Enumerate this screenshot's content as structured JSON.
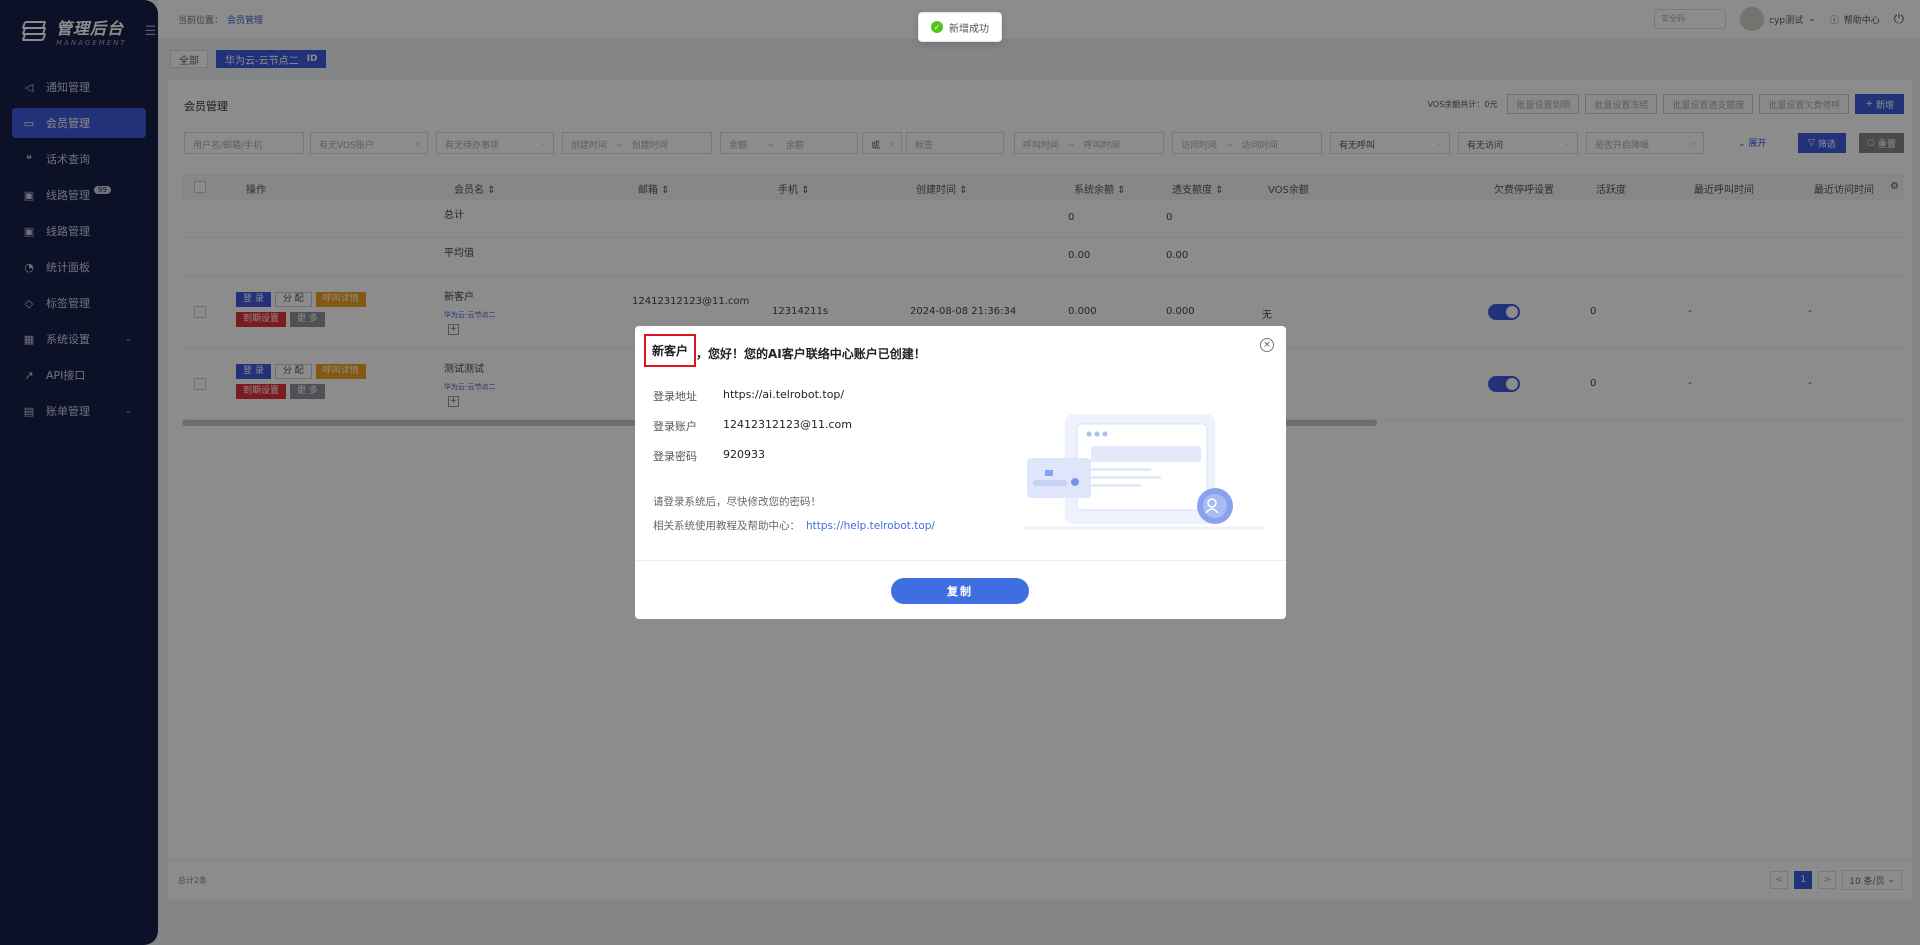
{
  "app": {
    "logo_title": "管理后台",
    "logo_sub": "MANAGEMENT"
  },
  "sidebar": {
    "items": [
      {
        "label": "通知管理",
        "icon": "bell-icon"
      },
      {
        "label": "会员管理",
        "icon": "member-icon",
        "active": true
      },
      {
        "label": "话术查询",
        "icon": "quote-icon"
      },
      {
        "label": "线路管理",
        "icon": "line-icon",
        "badge": "99"
      },
      {
        "label": "线路管理",
        "icon": "line-icon"
      },
      {
        "label": "统计面板",
        "icon": "chart-icon"
      },
      {
        "label": "标签管理",
        "icon": "tag-icon"
      },
      {
        "label": "系统设置",
        "icon": "grid-icon",
        "has_children": true
      },
      {
        "label": "API接口",
        "icon": "rocket-icon"
      },
      {
        "label": "账单管理",
        "icon": "bill-icon",
        "has_children": true
      }
    ]
  },
  "header": {
    "crumb_label": "当前位置：",
    "crumb_current": "会员管理",
    "security_placeholder": "安全码",
    "user_name": "cyp测试",
    "help": "帮助中心"
  },
  "toast": {
    "text": "新增成功"
  },
  "tabs": {
    "all": "全部",
    "node": "华为云-云节点二",
    "node_id": "ID"
  },
  "card": {
    "title": "会员管理",
    "vos_balance": "VOS余额共计：0元",
    "batch_btns": [
      "批量设置到期",
      "批量设置冻结",
      "批量设置透支额度",
      "批量设置欠费停呼"
    ],
    "add_btn": "新增",
    "expand": "展开",
    "filter_btn": "筛选",
    "reset_btn": "重置"
  },
  "filters": {
    "user": "用户名/邮箱/手机",
    "vos": "有无VOS账户",
    "todo": "有无待办事项",
    "created_from": "创建时间",
    "created_to": "创建时间",
    "balance_from": "余额",
    "balance_to": "余额",
    "or": "或",
    "tag": "标签",
    "call_from": "呼叫时间",
    "call_to": "呼叫时间",
    "visit_from": "访问时间",
    "visit_to": "访问时间",
    "has_call": "有无呼叫",
    "has_visit": "有无访问",
    "alert": "是否开启降噪",
    "range_sep": "~"
  },
  "table": {
    "headers": [
      "操作",
      "会员名",
      "邮箱",
      "手机",
      "创建时间",
      "系统余额",
      "透支额度",
      "VOS余额",
      "欠费停呼设置",
      "活跃度",
      "最近呼叫时间",
      "最近访问时间"
    ],
    "total_row": {
      "label": "总计",
      "balance": "0",
      "overdraft": "0"
    },
    "avg_row": {
      "label": "平均值",
      "balance": "0.00",
      "overdraft": "0.00"
    },
    "action_labels": {
      "login": "登 录",
      "assign": "分 配",
      "call_detail": "呼叫详情",
      "expiry": "到期设置",
      "more": "更 多"
    },
    "rows": [
      {
        "name": "新客户",
        "node": "华为云-云节点二",
        "email": "12412312123@11.com",
        "phone": "12314211s",
        "created": "2024-08-08 21:36:34",
        "balance": "0.000",
        "overdraft": "0.000",
        "vos": "无",
        "activity": "0",
        "last_call": "-",
        "last_visit": "-"
      },
      {
        "name": "测试测试",
        "node": "华为云-云节点二",
        "activity": "0",
        "last_call": "-",
        "last_visit": "-"
      }
    ]
  },
  "footer": {
    "total": "总计2条",
    "page": "1",
    "page_size": "10 条/页",
    "prev": "<",
    "next": ">"
  },
  "modal": {
    "name": "新客户",
    "title_rest": "，您好！您的AI客户联络中心账户已创建！",
    "login_url_label": "登录地址",
    "login_url": "https://ai.telrobot.top/",
    "account_label": "登录账户",
    "account": "12412312123@11.com",
    "password_label": "登录密码",
    "password": "920933",
    "note1": "请登录系统后，尽快修改您的密码！",
    "note2": "相关系统使用教程及帮助中心：",
    "help_url": "https://help.telrobot.top/",
    "copy_btn": "复制"
  }
}
